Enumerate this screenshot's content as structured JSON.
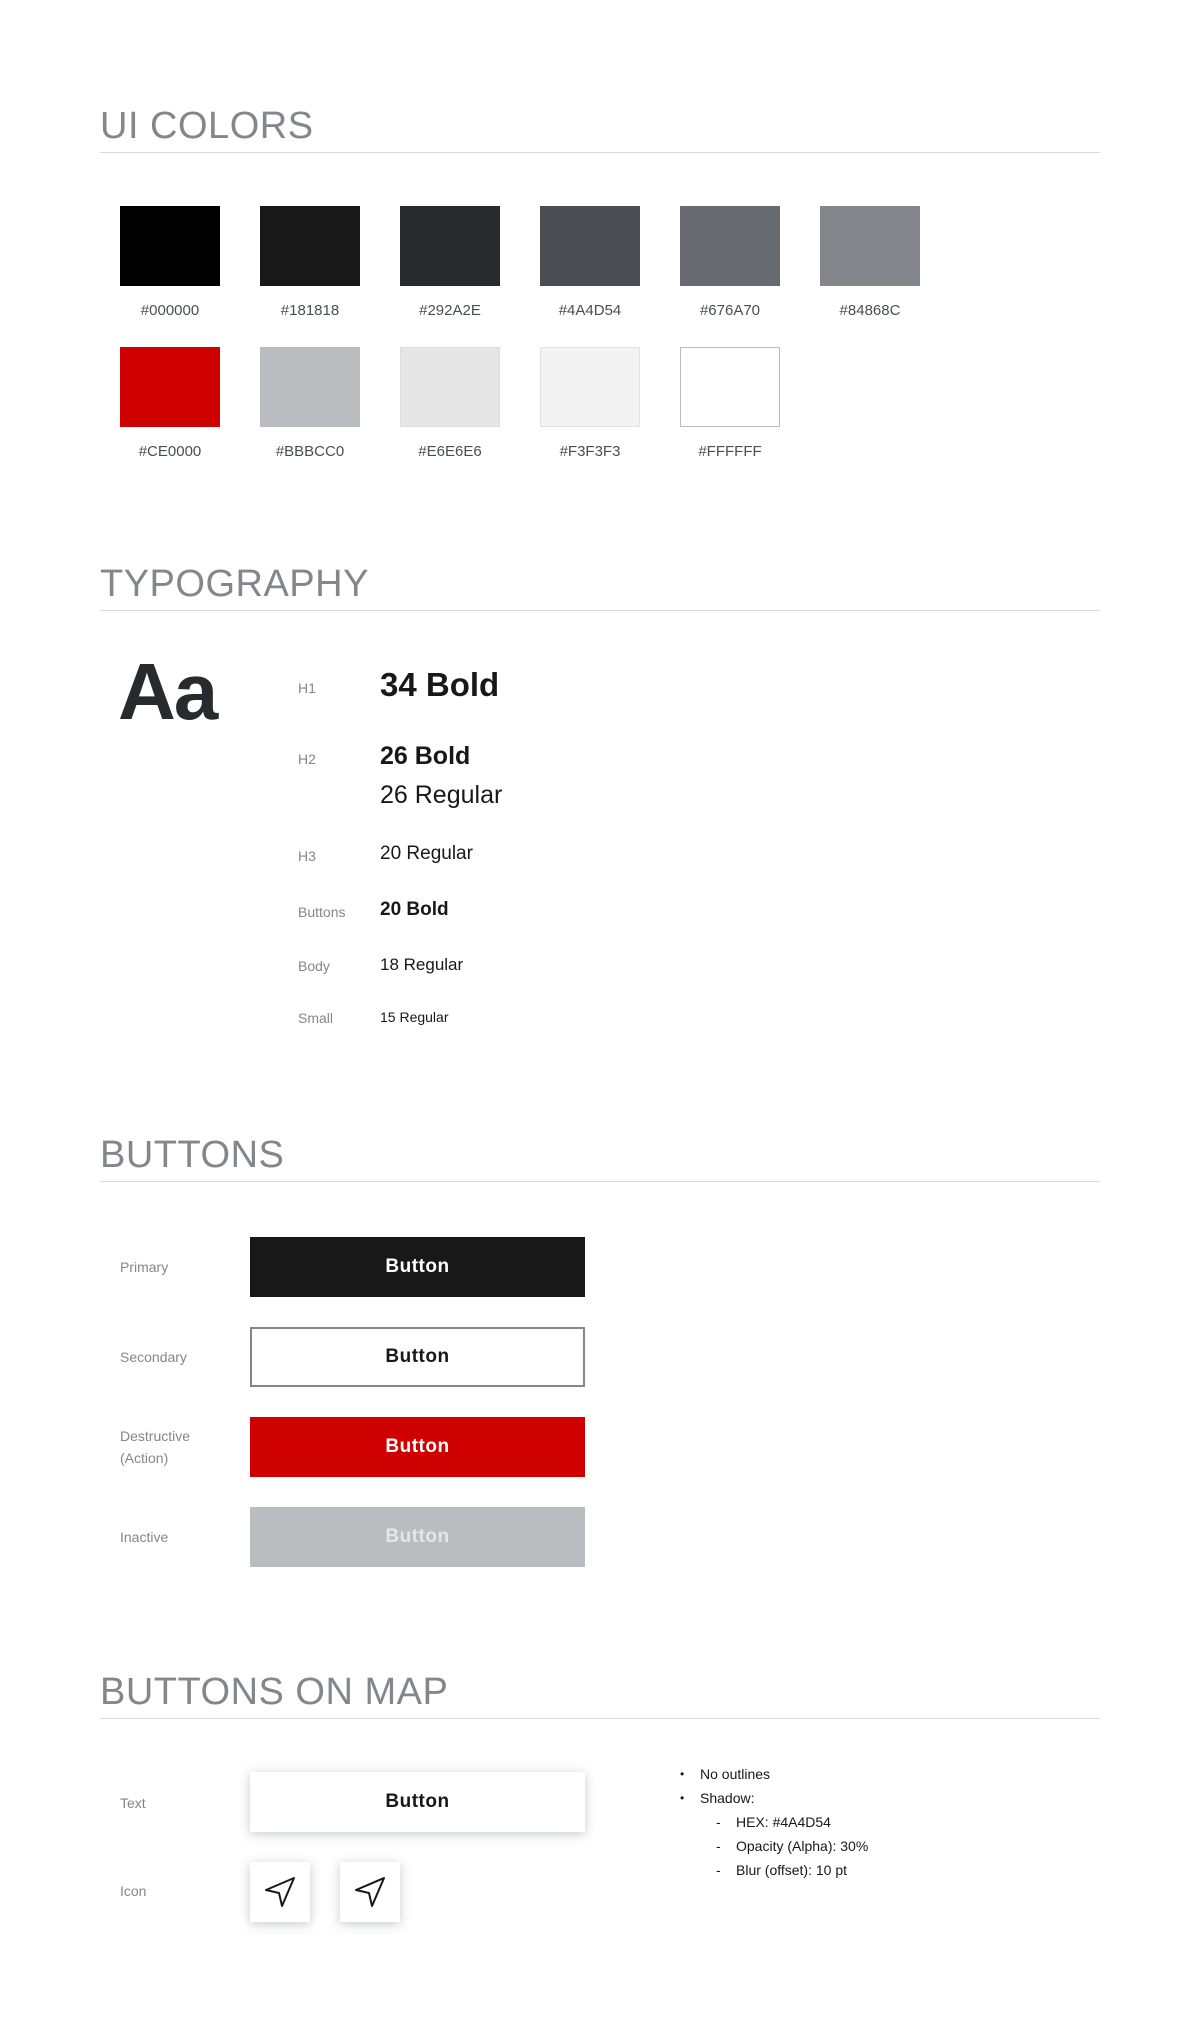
{
  "sections": {
    "colors": "UI COLORS",
    "typography": "TYPOGRAPHY",
    "buttons": "BUTTONS",
    "buttons_on_map": "BUTTONS ON MAP"
  },
  "colors": [
    {
      "hex": "#000000",
      "label": "#000000"
    },
    {
      "hex": "#181818",
      "label": "#181818"
    },
    {
      "hex": "#292A2E",
      "label": "#292A2E"
    },
    {
      "hex": "#4A4D54",
      "label": "#4A4D54"
    },
    {
      "hex": "#676A70",
      "label": "#676A70"
    },
    {
      "hex": "#84868C",
      "label": "#84868C"
    },
    {
      "hex": "#CE0000",
      "label": "#CE0000"
    },
    {
      "hex": "#BBBCC0",
      "label": "#BBBCC0"
    },
    {
      "hex": "#E6E6E6",
      "label": "#E6E6E6"
    },
    {
      "hex": "#F3F3F3",
      "label": "#F3F3F3"
    },
    {
      "hex": "#FFFFFF",
      "label": "#FFFFFF"
    }
  ],
  "typography": {
    "specimen": "Aa",
    "rows": [
      {
        "label": "H1",
        "samples": [
          "34 Bold"
        ]
      },
      {
        "label": "H2",
        "samples": [
          "26 Bold",
          "26 Regular"
        ]
      },
      {
        "label": "H3",
        "samples": [
          "20 Regular"
        ]
      },
      {
        "label": "Buttons",
        "samples": [
          "20 Bold"
        ]
      },
      {
        "label": "Body",
        "samples": [
          "18 Regular"
        ]
      },
      {
        "label": "Small",
        "samples": [
          "15 Regular"
        ]
      }
    ]
  },
  "buttons": [
    {
      "label": "Primary",
      "text": "Button",
      "variant": "primary"
    },
    {
      "label": "Secondary",
      "text": "Button",
      "variant": "secondary"
    },
    {
      "label": "Destructive (Action)",
      "text": "Button",
      "variant": "destructive"
    },
    {
      "label": "Inactive",
      "text": "Button",
      "variant": "inactive"
    }
  ],
  "map_buttons": {
    "text_label": "Text",
    "text_button": "Button",
    "icon_label": "Icon",
    "icons": [
      "navigation-arrow-icon",
      "navigation-arrow-icon"
    ],
    "notes": {
      "no_outlines": "No outlines",
      "shadow": "Shadow:",
      "shadow_hex": "HEX: #4A4D54",
      "shadow_opacity": "Opacity (Alpha): 30%",
      "shadow_blur": "Blur (offset): 10 pt"
    }
  }
}
